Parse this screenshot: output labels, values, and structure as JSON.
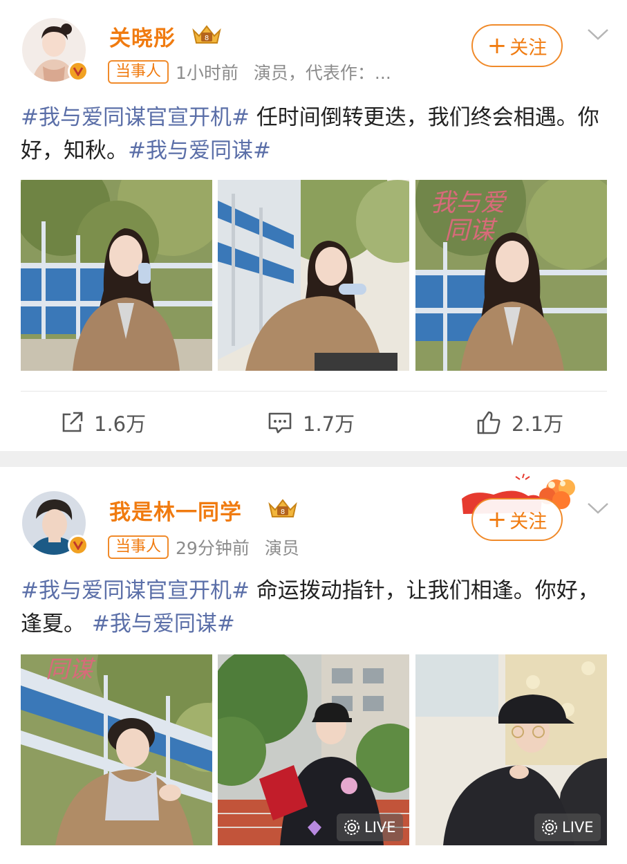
{
  "posts": [
    {
      "author": "关晓彤",
      "tag": "当事人",
      "time": "1小时前",
      "role": "演员，代表作：...",
      "follow_label": "关注",
      "content": {
        "topic1": "#我与爱同谋官宣开机#",
        "body": "任时间倒转更迭，我们终会相遇。你好，知秋。",
        "topic2": "#我与爱同谋#"
      },
      "images": [
        {
          "id": "photo-1"
        },
        {
          "id": "photo-2"
        },
        {
          "id": "photo-3",
          "overlay_title": [
            "我与爱",
            "同谋"
          ]
        }
      ],
      "stats": {
        "repost": "1.6万",
        "comment": "1.7万",
        "like": "2.1万"
      }
    },
    {
      "author": "我是林一同学",
      "tag": "当事人",
      "time": "29分钟前",
      "role": "演员",
      "follow_label": "关注",
      "content": {
        "topic1": "#我与爱同谋官宣开机#",
        "body": "命运拨动指针，让我们相逢。你好，逢夏。",
        "topic2": "#我与爱同谋#"
      },
      "images": [
        {
          "id": "photo-4",
          "overlay_title": [
            "同谋"
          ]
        },
        {
          "id": "photo-5",
          "badge": "LIVE"
        },
        {
          "id": "photo-6",
          "badge": "LIVE"
        }
      ]
    }
  ],
  "colors": {
    "accent": "#f07b10",
    "topic": "#5b6fa8",
    "muted": "#8c8c8c",
    "separator": "#efefef"
  },
  "icons": [
    "crown-badge-icon",
    "verified-v-icon",
    "plus-icon",
    "chevron-down-icon",
    "repost-icon",
    "comment-icon",
    "like-icon",
    "live-icon"
  ]
}
